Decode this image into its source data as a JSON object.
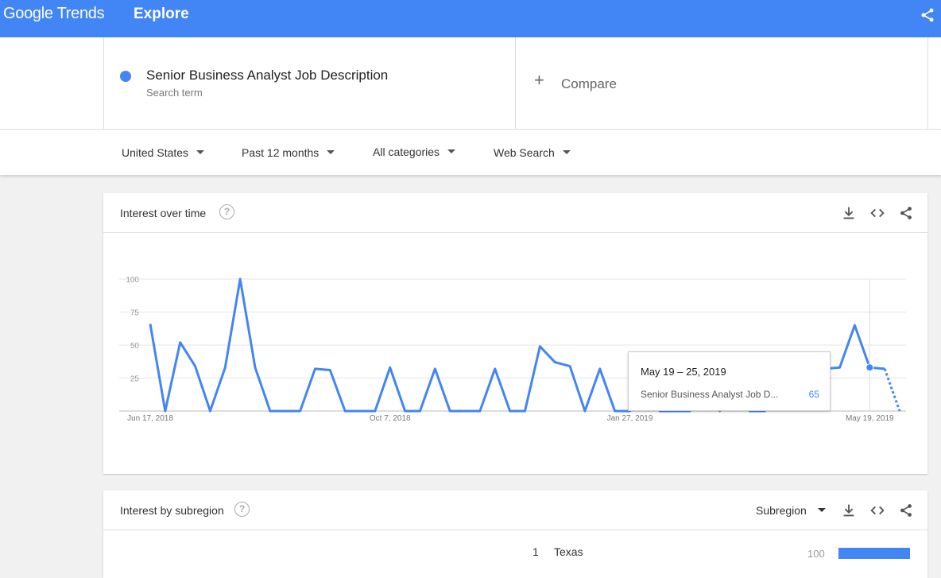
{
  "header": {
    "logo_text": "Google Trends",
    "nav_title": "Explore",
    "share_icon": "share-icon"
  },
  "term": {
    "title": "Senior Business Analyst Job Description",
    "subtitle": "Search term",
    "color": "#4285f4"
  },
  "compare": {
    "label": "Compare",
    "icon": "plus-icon"
  },
  "filters": [
    {
      "label": "United States"
    },
    {
      "label": "Past 12 months"
    },
    {
      "label": "All categories"
    },
    {
      "label": "Web Search"
    }
  ],
  "interest_over_time": {
    "title": "Interest over time",
    "tooltip": {
      "date": "May 19 – 25, 2019",
      "term": "Senior Business Analyst Job D...",
      "value": "65"
    }
  },
  "chart_data": {
    "type": "line",
    "series": [
      {
        "name": "Senior Business Analyst Job Description",
        "color": "#4285f4",
        "values": [
          66,
          0,
          52,
          34,
          0,
          33,
          100,
          33,
          0,
          0,
          0,
          32,
          31,
          0,
          0,
          0,
          33,
          0,
          0,
          32,
          0,
          0,
          0,
          32,
          0,
          0,
          49,
          37,
          34,
          0,
          32,
          0,
          0,
          30,
          0,
          0,
          0,
          30,
          0,
          32,
          0,
          0,
          32,
          33,
          31,
          32,
          33,
          65,
          33,
          32,
          0
        ],
        "partial_from_index": 49
      }
    ],
    "y_ticks": [
      "100",
      "75",
      "50",
      "25"
    ],
    "ylim": [
      0,
      100
    ],
    "x_tick_labels": [
      "Jun 17, 2018",
      "Oct 7, 2018",
      "Jan 27, 2019",
      "May 19, 2019"
    ],
    "x_tick_indices": [
      0,
      16,
      32,
      48
    ],
    "highlight_index": 48,
    "grid": true
  },
  "interest_by_subregion": {
    "title": "Interest by subregion",
    "select_label": "Subregion",
    "rows": [
      {
        "rank": "1",
        "name": "Texas",
        "value": "100",
        "fraction": 1.0
      }
    ]
  }
}
